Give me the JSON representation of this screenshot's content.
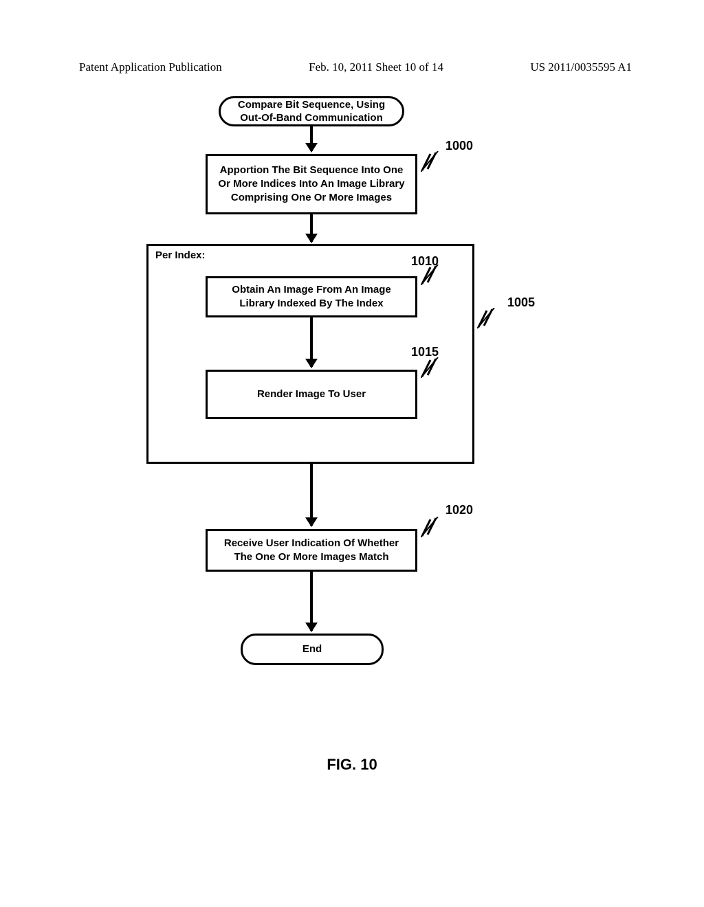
{
  "header": {
    "left": "Patent Application Publication",
    "center": "Feb. 10, 2011  Sheet 10 of 14",
    "right": "US 2011/0035595 A1"
  },
  "flowchart": {
    "start": "Compare Bit Sequence, Using Out-Of-Band Communication",
    "step1000": "Apportion The Bit Sequence Into One Or More Indices Into An Image Library Comprising One Or More Images",
    "containerLabel": "Per Index:",
    "step1010": "Obtain An Image From An Image Library Indexed By The Index",
    "step1015": "Render Image To User",
    "step1020": "Receive User Indication Of Whether The One Or More Images Match",
    "end": "End"
  },
  "refs": {
    "r1000": "1000",
    "r1005": "1005",
    "r1010": "1010",
    "r1015": "1015",
    "r1020": "1020"
  },
  "caption": "FIG. 10"
}
